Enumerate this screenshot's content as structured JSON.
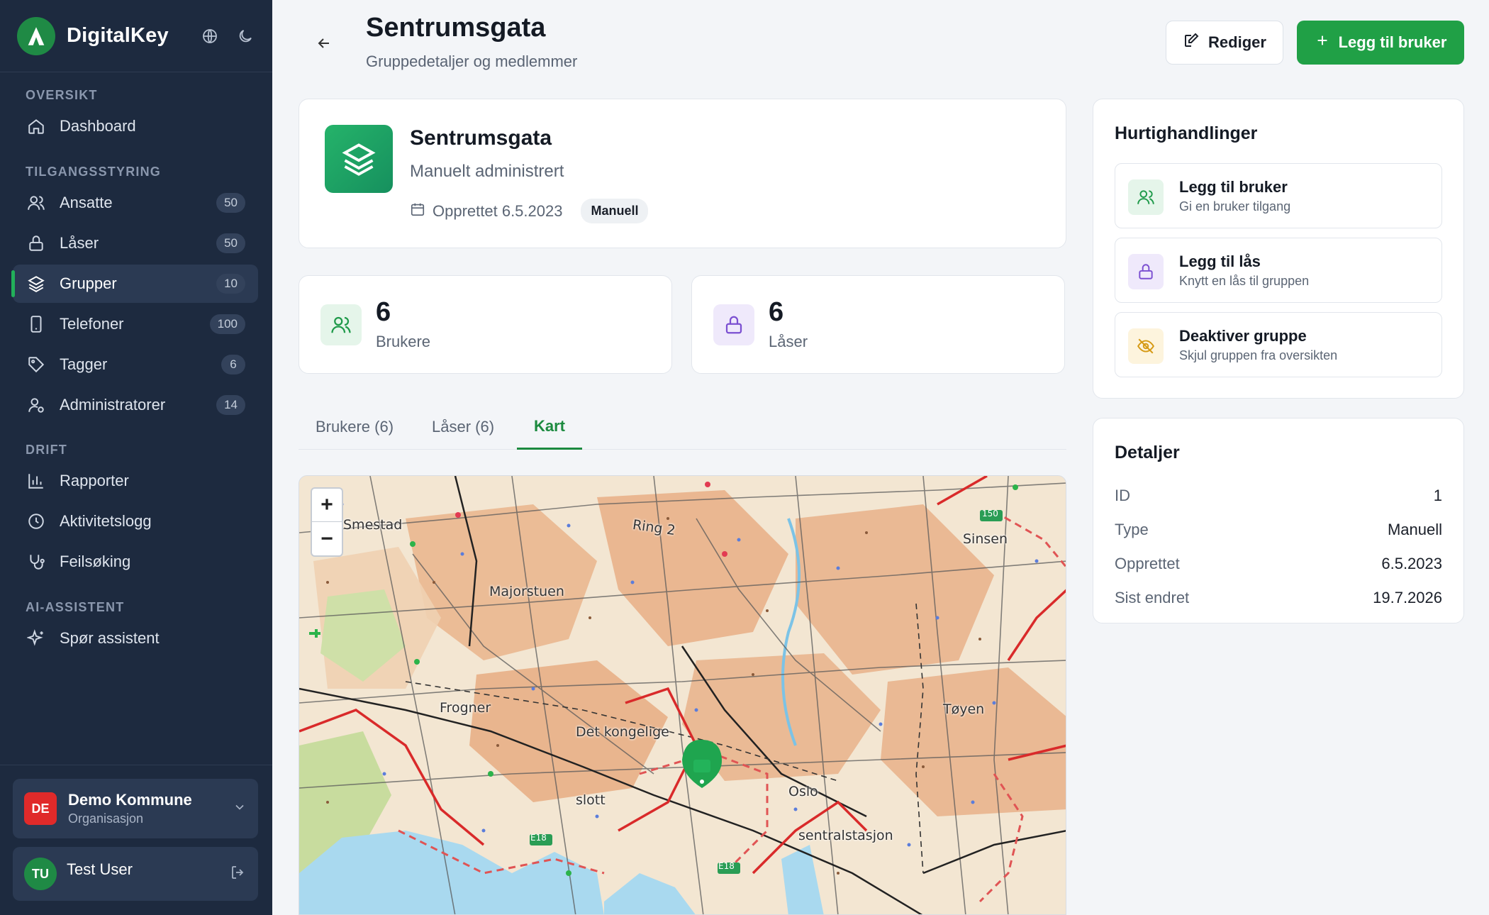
{
  "app": {
    "name": "DigitalKey"
  },
  "sidebar": {
    "sections": {
      "overview": "OVERSIKT",
      "access": "TILGANGSSTYRING",
      "ops": "DRIFT",
      "ai": "AI-ASSISTENT"
    },
    "items": [
      {
        "label": "Dashboard",
        "icon": "home-icon"
      },
      {
        "label": "Ansatte",
        "badge": "50",
        "icon": "users-icon"
      },
      {
        "label": "Låser",
        "badge": "50",
        "icon": "lock-icon"
      },
      {
        "label": "Grupper",
        "badge": "10",
        "icon": "layers-icon",
        "active": true
      },
      {
        "label": "Telefoner",
        "badge": "100",
        "icon": "phone-icon"
      },
      {
        "label": "Tagger",
        "badge": "6",
        "icon": "tag-icon"
      },
      {
        "label": "Administratorer",
        "badge": "14",
        "icon": "user-cog-icon"
      },
      {
        "label": "Rapporter",
        "icon": "bar-chart-icon"
      },
      {
        "label": "Aktivitetslogg",
        "icon": "clock-icon"
      },
      {
        "label": "Feilsøking",
        "icon": "stethoscope-icon"
      },
      {
        "label": "Spør assistent",
        "icon": "sparkles-icon"
      }
    ],
    "org": {
      "initials": "DE",
      "name": "Demo Kommune",
      "type": "Organisasjon"
    },
    "user": {
      "initials": "TU",
      "name": "Test User"
    }
  },
  "header": {
    "title": "Sentrumsgata",
    "subtitle": "Gruppedetaljer og medlemmer",
    "edit_label": "Rediger",
    "add_user_label": "Legg til bruker"
  },
  "group": {
    "name": "Sentrumsgata",
    "admin_mode": "Manuelt administrert",
    "created": "Opprettet 6.5.2023",
    "tag": "Manuell"
  },
  "stats": {
    "users": {
      "value": "6",
      "label": "Brukere"
    },
    "locks": {
      "value": "6",
      "label": "Låser"
    }
  },
  "tabs": [
    {
      "label": "Brukere (6)"
    },
    {
      "label": "Låser (6)"
    },
    {
      "label": "Kart",
      "active": true
    }
  ],
  "map": {
    "zoom_in": "+",
    "zoom_out": "−",
    "labels": [
      "Smestad",
      "Ring 2",
      "Majorstuen",
      "Sinsen",
      "Frogner",
      "Det kongelige",
      "slott",
      "Tøyen",
      "Oslo",
      "sentralstasjon",
      "E18",
      "150"
    ]
  },
  "quick_actions": {
    "title": "Hurtighandlinger",
    "items": [
      {
        "title": "Legg til bruker",
        "subtitle": "Gi en bruker tilgang",
        "icon": "users-icon"
      },
      {
        "title": "Legg til lås",
        "subtitle": "Knytt en lås til gruppen",
        "icon": "lock-icon"
      },
      {
        "title": "Deaktiver gruppe",
        "subtitle": "Skjul gruppen fra oversikten",
        "icon": "eye-off-icon"
      }
    ]
  },
  "details": {
    "title": "Detaljer",
    "rows": [
      {
        "key": "ID",
        "value": "1"
      },
      {
        "key": "Type",
        "value": "Manuell"
      },
      {
        "key": "Opprettet",
        "value": "6.5.2023"
      },
      {
        "key": "Sist endret",
        "value": "19.7.2026"
      }
    ]
  },
  "colors": {
    "accent": "#20a046",
    "sidebar": "#1d2a3f",
    "danger": "#e02a2a"
  }
}
